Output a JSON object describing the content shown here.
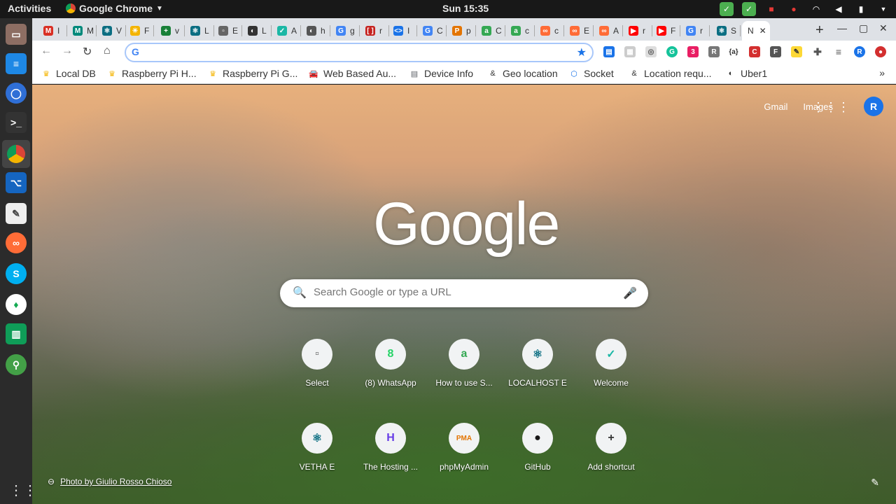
{
  "topbar": {
    "activities": "Activities",
    "app_name": "Google Chrome",
    "clock": "Sun 15:35"
  },
  "dock": {
    "items": [
      "files",
      "docs",
      "signal",
      "terminal",
      "chrome",
      "vscode",
      "text-editor",
      "postman",
      "skype",
      "mongodb",
      "app",
      "maps"
    ]
  },
  "tabs": [
    {
      "letter": "I",
      "icon": "gmail-icon",
      "color": "#d93025",
      "glyph": "M"
    },
    {
      "letter": "M",
      "icon": "meet-icon",
      "color": "#00897b",
      "glyph": "M"
    },
    {
      "letter": "V",
      "icon": "react-icon",
      "color": "#0b6e82",
      "glyph": "⚛"
    },
    {
      "letter": "F",
      "icon": "sun-icon",
      "color": "#f4b400",
      "glyph": "☀"
    },
    {
      "letter": "v",
      "icon": "plus-icon",
      "color": "#188038",
      "glyph": "+"
    },
    {
      "letter": "L",
      "icon": "react-icon",
      "color": "#0b6e82",
      "glyph": "⚛"
    },
    {
      "letter": "E",
      "icon": "select-icon",
      "color": "#666666",
      "glyph": "▫"
    },
    {
      "letter": "L",
      "icon": "globe-icon",
      "color": "#333333",
      "glyph": "◐"
    },
    {
      "letter": "A",
      "icon": "welcome-icon",
      "color": "#1bb7a5",
      "glyph": "✓"
    },
    {
      "letter": "h",
      "icon": "globe-icon",
      "color": "#555555",
      "glyph": "◐"
    },
    {
      "letter": "g",
      "icon": "google-icon",
      "color": "#4285f4",
      "glyph": "G"
    },
    {
      "letter": "r",
      "icon": "bracket-icon",
      "color": "#c5221f",
      "glyph": "[ ]"
    },
    {
      "letter": "I",
      "icon": "code-icon",
      "color": "#1a73e8",
      "glyph": "<>"
    },
    {
      "letter": "C",
      "icon": "google-icon",
      "color": "#4285f4",
      "glyph": "G"
    },
    {
      "letter": "p",
      "icon": "pma-icon",
      "color": "#e37400",
      "glyph": "P"
    },
    {
      "letter": "C",
      "icon": "a-icon",
      "color": "#34a853",
      "glyph": "a"
    },
    {
      "letter": "c",
      "icon": "a-icon",
      "color": "#34a853",
      "glyph": "a"
    },
    {
      "letter": "c",
      "icon": "postman-icon",
      "color": "#ff6c37",
      "glyph": "∞"
    },
    {
      "letter": "E",
      "icon": "postman-icon",
      "color": "#ff6c37",
      "glyph": "∞"
    },
    {
      "letter": "A",
      "icon": "postman-icon",
      "color": "#ff6c37",
      "glyph": "∞"
    },
    {
      "letter": "r",
      "icon": "youtube-icon",
      "color": "#ff0000",
      "glyph": "▶"
    },
    {
      "letter": "F",
      "icon": "youtube-icon",
      "color": "#ff0000",
      "glyph": "▶"
    },
    {
      "letter": "r",
      "icon": "google-icon",
      "color": "#4285f4",
      "glyph": "G"
    },
    {
      "letter": "S",
      "icon": "react-icon",
      "color": "#0b6e82",
      "glyph": "⚛"
    },
    {
      "letter": "N",
      "icon": "",
      "color": "#ffffff",
      "glyph": ""
    }
  ],
  "toolbar": {
    "omnibox_value": "",
    "omnibox_badge": "G"
  },
  "bookmarks": [
    {
      "label": "Local DB",
      "icon": "raspberry-icon",
      "glyph": "♛",
      "color": "#f4b400"
    },
    {
      "label": "Raspberry Pi H...",
      "icon": "raspberry-icon",
      "glyph": "♛",
      "color": "#f4b400"
    },
    {
      "label": "Raspberry Pi G...",
      "icon": "raspberry-icon",
      "glyph": "♛",
      "color": "#f4b400"
    },
    {
      "label": "Web Based Au...",
      "icon": "car-icon",
      "glyph": "🚘",
      "color": "#1a73e8"
    },
    {
      "label": "Device Info",
      "icon": "device-icon",
      "glyph": "▤",
      "color": "#5f6368"
    },
    {
      "label": "Geo location",
      "icon": "geo-icon",
      "glyph": "&",
      "color": "#333333"
    },
    {
      "label": "Socket",
      "icon": "socket-icon",
      "glyph": "⬡",
      "color": "#1a73e8"
    },
    {
      "label": "Location requ...",
      "icon": "geo-icon",
      "glyph": "&",
      "color": "#333333"
    },
    {
      "label": "Uber1",
      "icon": "globe-icon",
      "glyph": "◐",
      "color": "#333333"
    }
  ],
  "ntp": {
    "gmail": "Gmail",
    "images": "Images",
    "avatar": "R",
    "logo": "Google",
    "search_placeholder": "Search Google or type a URL",
    "shortcuts_row1": [
      {
        "label": "Select",
        "icon": "select-icon",
        "glyph": "▫",
        "color": "#666666"
      },
      {
        "label": "(8) WhatsApp",
        "icon": "whatsapp-icon",
        "glyph": "8",
        "color": "#25d366"
      },
      {
        "label": "How to use S...",
        "icon": "a-icon",
        "glyph": "a",
        "color": "#34a853"
      },
      {
        "label": "LOCALHOST E",
        "icon": "react-icon",
        "glyph": "⚛",
        "color": "#0b6e82"
      },
      {
        "label": "Welcome",
        "icon": "welcome-icon",
        "glyph": "✓",
        "color": "#1bb7a5"
      }
    ],
    "shortcuts_row2": [
      {
        "label": "VETHA E",
        "icon": "react-icon",
        "glyph": "⚛",
        "color": "#0b6e82"
      },
      {
        "label": "The Hosting ...",
        "icon": "hostinger-icon",
        "glyph": "H",
        "color": "#673de6"
      },
      {
        "label": "phpMyAdmin",
        "icon": "pma-icon",
        "glyph": "PMA",
        "color": "#e37400"
      },
      {
        "label": "GitHub",
        "icon": "github-icon",
        "glyph": "●",
        "color": "#181717"
      },
      {
        "label": "Add shortcut",
        "icon": "plus-icon",
        "glyph": "+",
        "color": "#333333"
      }
    ],
    "photo_credit": "Photo by Giulio Rosso Chioso"
  }
}
